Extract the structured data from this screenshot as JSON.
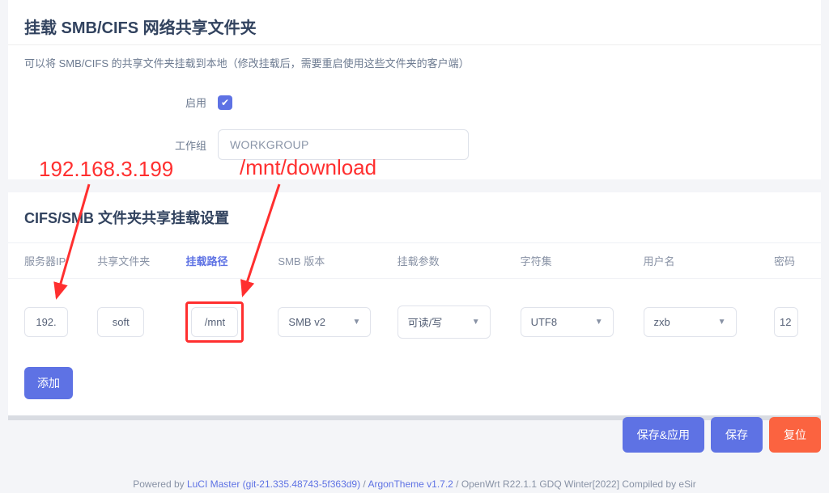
{
  "page": {
    "title": "挂载 SMB/CIFS 网络共享文件夹",
    "description": "可以将 SMB/CIFS 的共享文件夹挂载到本地（修改挂载后，需要重启使用这些文件夹的客户端）"
  },
  "form": {
    "enable_label": "启用",
    "enabled": true,
    "workgroup_label": "工作组",
    "workgroup_value": "WORKGROUP"
  },
  "section": {
    "title": "CIFS/SMB 文件夹共享挂载设置"
  },
  "headers": {
    "ip": "服务器IP",
    "share": "共享文件夹",
    "mountpoint": "挂载路径",
    "version": "SMB 版本",
    "options": "挂载参数",
    "charset": "字符集",
    "user": "用户名",
    "password": "密码"
  },
  "row": {
    "ip": "192.",
    "share": "soft",
    "mountpoint": "/mnt",
    "version": "SMB v2",
    "options": "可读/写",
    "charset": "UTF8",
    "user": "zxb",
    "password": "12"
  },
  "buttons": {
    "add": "添加",
    "save_apply": "保存&应用",
    "save": "保存",
    "reset": "复位"
  },
  "annotations": {
    "ip_full": "192.168.3.199",
    "mountpoint_full": "/mnt/download"
  },
  "footer": {
    "prefix": "Powered by ",
    "luci": "LuCI Master (git-21.335.48743-5f363d9)",
    "sep1": " / ",
    "theme": "ArgonTheme v1.7.2",
    "sep2": " / OpenWrt R22.1.1 GDQ Winter[2022] Compiled by eSir"
  }
}
